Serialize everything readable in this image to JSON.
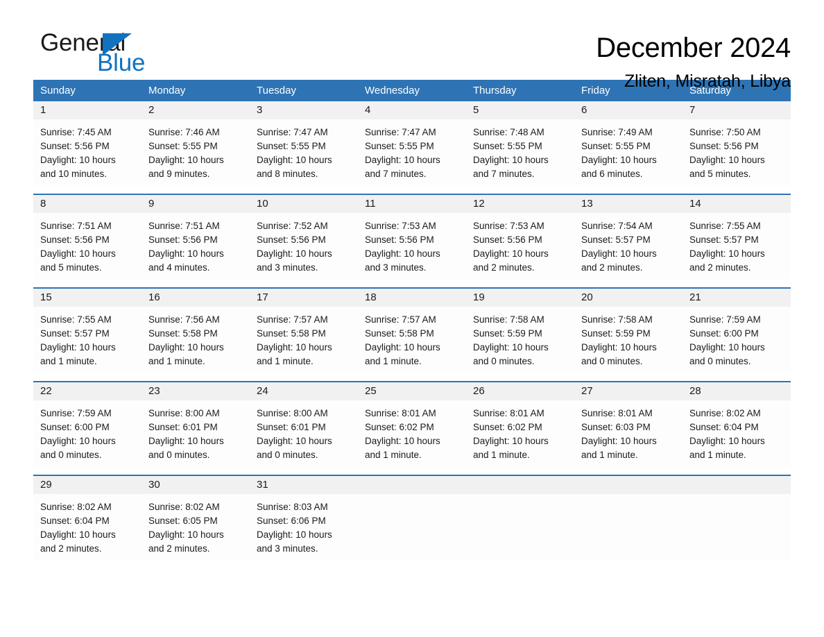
{
  "brand": {
    "name_top": "General",
    "name_bottom": "Blue",
    "accent_color": "#1272c0"
  },
  "header": {
    "title": "December 2024",
    "subtitle": "Zliten, Misratah, Libya"
  },
  "theme": {
    "header_blue": "#2e74b5",
    "date_band": "#f1f1f1",
    "text": "#1a1a1a"
  },
  "calendar": {
    "weekday_headers": [
      "Sunday",
      "Monday",
      "Tuesday",
      "Wednesday",
      "Thursday",
      "Friday",
      "Saturday"
    ],
    "weeks": [
      [
        {
          "day": "1",
          "sunrise": "Sunrise: 7:45 AM",
          "sunset": "Sunset: 5:56 PM",
          "daylight_1": "Daylight: 10 hours",
          "daylight_2": "and 10 minutes."
        },
        {
          "day": "2",
          "sunrise": "Sunrise: 7:46 AM",
          "sunset": "Sunset: 5:55 PM",
          "daylight_1": "Daylight: 10 hours",
          "daylight_2": "and 9 minutes."
        },
        {
          "day": "3",
          "sunrise": "Sunrise: 7:47 AM",
          "sunset": "Sunset: 5:55 PM",
          "daylight_1": "Daylight: 10 hours",
          "daylight_2": "and 8 minutes."
        },
        {
          "day": "4",
          "sunrise": "Sunrise: 7:47 AM",
          "sunset": "Sunset: 5:55 PM",
          "daylight_1": "Daylight: 10 hours",
          "daylight_2": "and 7 minutes."
        },
        {
          "day": "5",
          "sunrise": "Sunrise: 7:48 AM",
          "sunset": "Sunset: 5:55 PM",
          "daylight_1": "Daylight: 10 hours",
          "daylight_2": "and 7 minutes."
        },
        {
          "day": "6",
          "sunrise": "Sunrise: 7:49 AM",
          "sunset": "Sunset: 5:55 PM",
          "daylight_1": "Daylight: 10 hours",
          "daylight_2": "and 6 minutes."
        },
        {
          "day": "7",
          "sunrise": "Sunrise: 7:50 AM",
          "sunset": "Sunset: 5:56 PM",
          "daylight_1": "Daylight: 10 hours",
          "daylight_2": "and 5 minutes."
        }
      ],
      [
        {
          "day": "8",
          "sunrise": "Sunrise: 7:51 AM",
          "sunset": "Sunset: 5:56 PM",
          "daylight_1": "Daylight: 10 hours",
          "daylight_2": "and 5 minutes."
        },
        {
          "day": "9",
          "sunrise": "Sunrise: 7:51 AM",
          "sunset": "Sunset: 5:56 PM",
          "daylight_1": "Daylight: 10 hours",
          "daylight_2": "and 4 minutes."
        },
        {
          "day": "10",
          "sunrise": "Sunrise: 7:52 AM",
          "sunset": "Sunset: 5:56 PM",
          "daylight_1": "Daylight: 10 hours",
          "daylight_2": "and 3 minutes."
        },
        {
          "day": "11",
          "sunrise": "Sunrise: 7:53 AM",
          "sunset": "Sunset: 5:56 PM",
          "daylight_1": "Daylight: 10 hours",
          "daylight_2": "and 3 minutes."
        },
        {
          "day": "12",
          "sunrise": "Sunrise: 7:53 AM",
          "sunset": "Sunset: 5:56 PM",
          "daylight_1": "Daylight: 10 hours",
          "daylight_2": "and 2 minutes."
        },
        {
          "day": "13",
          "sunrise": "Sunrise: 7:54 AM",
          "sunset": "Sunset: 5:57 PM",
          "daylight_1": "Daylight: 10 hours",
          "daylight_2": "and 2 minutes."
        },
        {
          "day": "14",
          "sunrise": "Sunrise: 7:55 AM",
          "sunset": "Sunset: 5:57 PM",
          "daylight_1": "Daylight: 10 hours",
          "daylight_2": "and 2 minutes."
        }
      ],
      [
        {
          "day": "15",
          "sunrise": "Sunrise: 7:55 AM",
          "sunset": "Sunset: 5:57 PM",
          "daylight_1": "Daylight: 10 hours",
          "daylight_2": "and 1 minute."
        },
        {
          "day": "16",
          "sunrise": "Sunrise: 7:56 AM",
          "sunset": "Sunset: 5:58 PM",
          "daylight_1": "Daylight: 10 hours",
          "daylight_2": "and 1 minute."
        },
        {
          "day": "17",
          "sunrise": "Sunrise: 7:57 AM",
          "sunset": "Sunset: 5:58 PM",
          "daylight_1": "Daylight: 10 hours",
          "daylight_2": "and 1 minute."
        },
        {
          "day": "18",
          "sunrise": "Sunrise: 7:57 AM",
          "sunset": "Sunset: 5:58 PM",
          "daylight_1": "Daylight: 10 hours",
          "daylight_2": "and 1 minute."
        },
        {
          "day": "19",
          "sunrise": "Sunrise: 7:58 AM",
          "sunset": "Sunset: 5:59 PM",
          "daylight_1": "Daylight: 10 hours",
          "daylight_2": "and 0 minutes."
        },
        {
          "day": "20",
          "sunrise": "Sunrise: 7:58 AM",
          "sunset": "Sunset: 5:59 PM",
          "daylight_1": "Daylight: 10 hours",
          "daylight_2": "and 0 minutes."
        },
        {
          "day": "21",
          "sunrise": "Sunrise: 7:59 AM",
          "sunset": "Sunset: 6:00 PM",
          "daylight_1": "Daylight: 10 hours",
          "daylight_2": "and 0 minutes."
        }
      ],
      [
        {
          "day": "22",
          "sunrise": "Sunrise: 7:59 AM",
          "sunset": "Sunset: 6:00 PM",
          "daylight_1": "Daylight: 10 hours",
          "daylight_2": "and 0 minutes."
        },
        {
          "day": "23",
          "sunrise": "Sunrise: 8:00 AM",
          "sunset": "Sunset: 6:01 PM",
          "daylight_1": "Daylight: 10 hours",
          "daylight_2": "and 0 minutes."
        },
        {
          "day": "24",
          "sunrise": "Sunrise: 8:00 AM",
          "sunset": "Sunset: 6:01 PM",
          "daylight_1": "Daylight: 10 hours",
          "daylight_2": "and 0 minutes."
        },
        {
          "day": "25",
          "sunrise": "Sunrise: 8:01 AM",
          "sunset": "Sunset: 6:02 PM",
          "daylight_1": "Daylight: 10 hours",
          "daylight_2": "and 1 minute."
        },
        {
          "day": "26",
          "sunrise": "Sunrise: 8:01 AM",
          "sunset": "Sunset: 6:02 PM",
          "daylight_1": "Daylight: 10 hours",
          "daylight_2": "and 1 minute."
        },
        {
          "day": "27",
          "sunrise": "Sunrise: 8:01 AM",
          "sunset": "Sunset: 6:03 PM",
          "daylight_1": "Daylight: 10 hours",
          "daylight_2": "and 1 minute."
        },
        {
          "day": "28",
          "sunrise": "Sunrise: 8:02 AM",
          "sunset": "Sunset: 6:04 PM",
          "daylight_1": "Daylight: 10 hours",
          "daylight_2": "and 1 minute."
        }
      ],
      [
        {
          "day": "29",
          "sunrise": "Sunrise: 8:02 AM",
          "sunset": "Sunset: 6:04 PM",
          "daylight_1": "Daylight: 10 hours",
          "daylight_2": "and 2 minutes."
        },
        {
          "day": "30",
          "sunrise": "Sunrise: 8:02 AM",
          "sunset": "Sunset: 6:05 PM",
          "daylight_1": "Daylight: 10 hours",
          "daylight_2": "and 2 minutes."
        },
        {
          "day": "31",
          "sunrise": "Sunrise: 8:03 AM",
          "sunset": "Sunset: 6:06 PM",
          "daylight_1": "Daylight: 10 hours",
          "daylight_2": "and 3 minutes."
        },
        {
          "day": "",
          "sunrise": "",
          "sunset": "",
          "daylight_1": "",
          "daylight_2": ""
        },
        {
          "day": "",
          "sunrise": "",
          "sunset": "",
          "daylight_1": "",
          "daylight_2": ""
        },
        {
          "day": "",
          "sunrise": "",
          "sunset": "",
          "daylight_1": "",
          "daylight_2": ""
        },
        {
          "day": "",
          "sunrise": "",
          "sunset": "",
          "daylight_1": "",
          "daylight_2": ""
        }
      ]
    ]
  }
}
